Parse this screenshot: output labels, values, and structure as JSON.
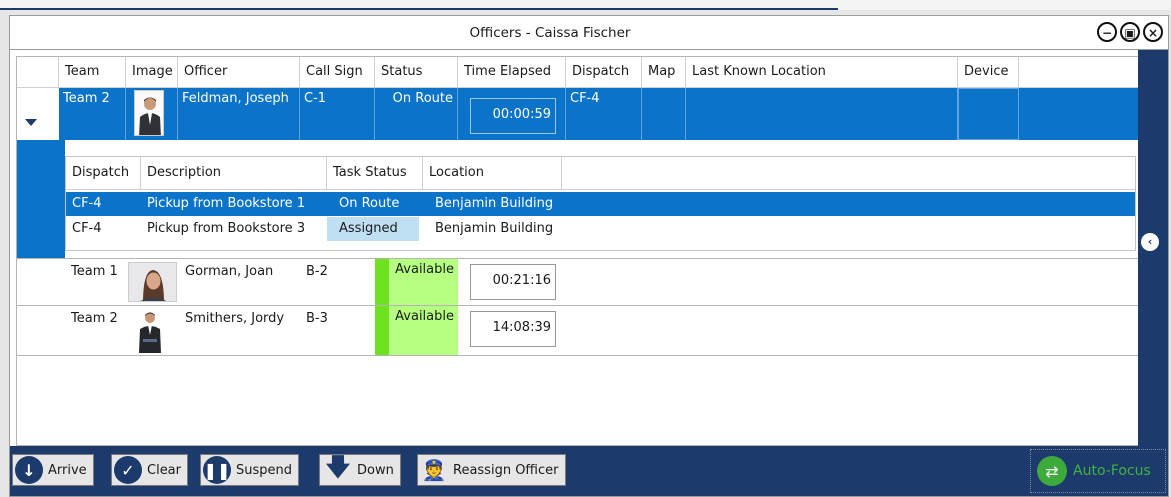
{
  "window": {
    "title": "Officers - Caissa Fischer",
    "minimize_icon": "minimize-icon",
    "restore_icon": "restore-icon",
    "close_icon": "close-icon"
  },
  "grid": {
    "columns": [
      "Team",
      "Image",
      "Officer",
      "Call Sign",
      "Status",
      "Time Elapsed",
      "Dispatch",
      "Map",
      "Last Known Location",
      "Device"
    ],
    "rows": [
      {
        "team": "Team 2",
        "officer": "Feldman, Joseph",
        "call_sign": "C-1",
        "status": "On Route",
        "time_elapsed": "00:00:59",
        "dispatch": "CF-4",
        "selected": true,
        "expanded": true
      },
      {
        "team": "Team 1",
        "officer": "Gorman, Joan",
        "call_sign": "B-2",
        "status": "Available",
        "time_elapsed": "00:21:16",
        "dispatch": "",
        "selected": false
      },
      {
        "team": "Team 2",
        "officer": "Smithers, Jordy",
        "call_sign": "B-3",
        "status": "Available",
        "time_elapsed": "14:08:39",
        "dispatch": "",
        "selected": false
      }
    ],
    "sub_grid": {
      "columns": [
        "Dispatch",
        "Description",
        "Task Status",
        "Location"
      ],
      "rows": [
        {
          "dispatch": "CF-4",
          "description": "Pickup from Bookstore 1",
          "task_status": "On Route",
          "location": "Benjamin Building",
          "selected": true
        },
        {
          "dispatch": "CF-4",
          "description": "Pickup from Bookstore 3",
          "task_status": "Assigned",
          "location": "Benjamin Building",
          "selected": false
        }
      ]
    }
  },
  "toolbar": {
    "arrive": "Arrive",
    "clear": "Clear",
    "suspend": "Suspend",
    "down": "Down",
    "reassign": "Reassign Officer",
    "auto_focus": "Auto-Focus"
  },
  "colors": {
    "accent": "#0c74c8",
    "frame": "#1c3a6b",
    "available": "#b6ff80",
    "available_strip": "#6ee21e",
    "assigned": "#bfe0f2",
    "auto_focus": "#3cab3c"
  }
}
